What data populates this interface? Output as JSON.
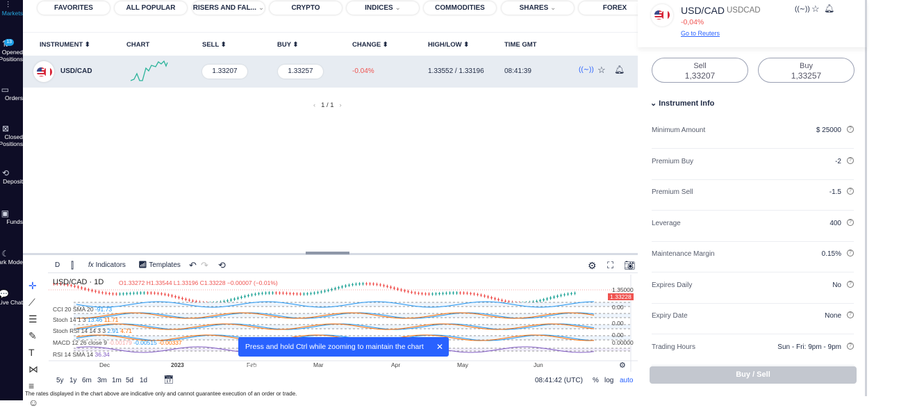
{
  "sidebar": {
    "items": [
      {
        "label": "Markets",
        "icon": "candles-icon"
      },
      {
        "label": "Opened Positions",
        "icon": "positions-icon",
        "badge": "13"
      },
      {
        "label": "Orders",
        "icon": "orders-icon"
      },
      {
        "label": "Closed Positions",
        "icon": "closed-icon"
      },
      {
        "label": "Deposit",
        "icon": "deposit-icon"
      },
      {
        "label": "Funds",
        "icon": "funds-icon"
      },
      {
        "label": "Dark Mode",
        "icon": "moon-icon"
      },
      {
        "label": "Live Chat",
        "icon": "chat-icon"
      }
    ]
  },
  "tabs": [
    "FAVORITES",
    "ALL POPULAR",
    "RISERS AND FAL...",
    "CRYPTO",
    "INDICES",
    "COMMODITIES",
    "SHARES",
    "FOREX"
  ],
  "table": {
    "headers": [
      "INSTRUMENT",
      "CHART",
      "SELL",
      "BUY",
      "CHANGE",
      "HIGH/LOW",
      "TIME GMT"
    ],
    "rows": [
      {
        "instrument": "USD/CAD",
        "sell": "1.33207",
        "buy": "1.33257",
        "change": "-0.04%",
        "highlow": "1.33552 / 1.33196",
        "time": "08:41:39"
      }
    ]
  },
  "pagination": "1 / 1",
  "chart": {
    "toolbar": {
      "interval": "D",
      "indicators": "Indicators",
      "templates": "Templates"
    },
    "symbol": "USD/CAD · 1D",
    "ohlc": "O1.33272 H1.33544 L1.33196 C1.33228 −0.00007 (−0.01%)",
    "indicators": [
      {
        "name": "CCI 20 SMA 20",
        "values": [
          "-91.73"
        ],
        "colors": [
          "#2196f3"
        ]
      },
      {
        "name": "Stoch 14 1 3",
        "values": [
          "13.46",
          "11.71"
        ],
        "colors": [
          "#2196f3",
          "#ff6d00"
        ]
      },
      {
        "name": "Stoch RSI 14 14 3 3",
        "values": [
          "2.91",
          "4.71"
        ],
        "colors": [
          "#2196f3",
          "#ff6d00"
        ]
      },
      {
        "name": "MACD 12 26 close 9",
        "values": [
          "-0.00179",
          "-0.00515",
          "-0.00337"
        ],
        "colors": [
          "#f7a8a8",
          "#2196f3",
          "#ff6d00"
        ]
      },
      {
        "name": "RSI 14 SMA 14",
        "values": [
          "36.34"
        ],
        "colors": [
          "#7e57c2"
        ]
      }
    ],
    "price_labels": [
      "1.35000",
      "1.33228",
      "0.00",
      "0.00",
      "0.00",
      "0.00000"
    ],
    "months": [
      "Dec",
      "2023",
      "Feb",
      "Mar",
      "Apr",
      "May",
      "Jun"
    ],
    "ranges": [
      "5y",
      "1y",
      "6m",
      "3m",
      "1m",
      "5d",
      "1d"
    ],
    "clock": "08:41:42 (UTC)",
    "pct": "%",
    "log": "log",
    "auto": "auto",
    "toast": "Press and hold Ctrl while zooming to maintain the chart position",
    "disclaimer": "The rates displayed in the chart above are indicative only and cannot guarantee execution of an order or trade."
  },
  "panel": {
    "title": "USD/CAD",
    "code": "USDCAD",
    "change": "-0,04%",
    "reuters": "Go to Reuters",
    "sell_label": "Sell",
    "sell_value": "1,33207",
    "buy_label": "Buy",
    "buy_value": "1,33257",
    "section": "Instrument Info",
    "info": [
      {
        "label": "Minimum Amount",
        "value": "$ 25000"
      },
      {
        "label": "Premium Buy",
        "value": "-2"
      },
      {
        "label": "Premium Sell",
        "value": "-1.5"
      },
      {
        "label": "Leverage",
        "value": "400"
      },
      {
        "label": "Maintenance Margin",
        "value": "0.15%"
      },
      {
        "label": "Expires Daily",
        "value": "No"
      },
      {
        "label": "Expiry Date",
        "value": "None"
      },
      {
        "label": "Trading Hours",
        "value": "Sun - Fri: 9pm - 9pm"
      }
    ],
    "action": "Buy / Sell"
  },
  "colors": {
    "up": "#26a69a",
    "down": "#ef5350",
    "accent": "#2962ff",
    "negative": "#ef5350"
  }
}
